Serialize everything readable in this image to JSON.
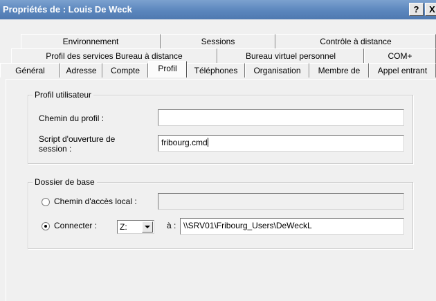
{
  "window": {
    "title": "Propriétés de : Louis De Weck",
    "help_label": "?",
    "close_label": "X"
  },
  "tabs": {
    "row1": [
      "Environnement",
      "Sessions",
      "Contrôle à distance"
    ],
    "row2": [
      "Profil des services Bureau à distance",
      "Bureau virtuel personnel",
      "COM+"
    ],
    "row3": [
      "Général",
      "Adresse",
      "Compte",
      "Profil",
      "Téléphones",
      "Organisation",
      "Membre de",
      "Appel entrant"
    ],
    "active": "Profil"
  },
  "profile_group": {
    "legend": "Profil utilisateur",
    "profile_path_label": "Chemin du profil :",
    "profile_path_value": "",
    "logon_script_label_1": "Script d'ouverture de",
    "logon_script_label_2": "session :",
    "logon_script_value": "fribourg.cmd"
  },
  "home_group": {
    "legend": "Dossier de base",
    "local_path_label": "Chemin d'accès local :",
    "local_path_value": "",
    "local_path_selected": false,
    "connect_label": "Connecter :",
    "connect_selected": true,
    "drive_value": "Z:",
    "to_label": "à :",
    "unc_value": "\\\\SRV01\\Fribourg_Users\\DeWeckL"
  }
}
